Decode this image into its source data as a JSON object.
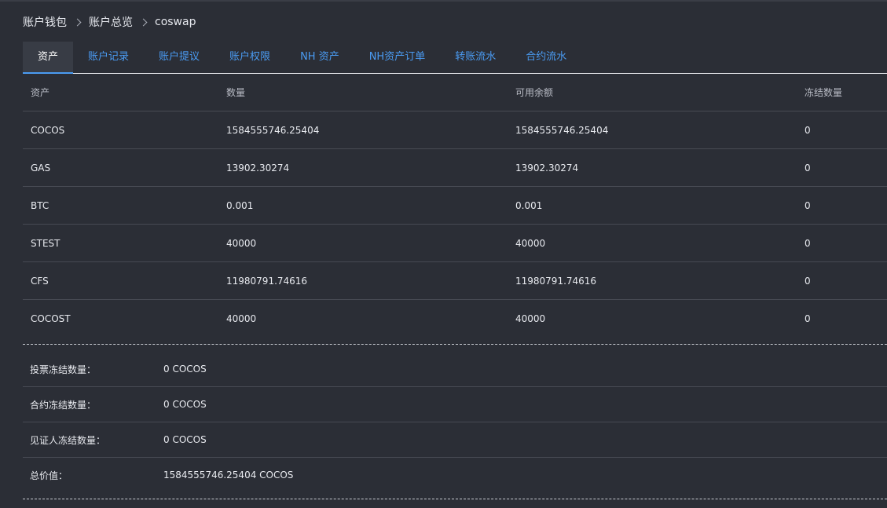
{
  "breadcrumb": [
    "账户钱包",
    "账户总览",
    "coswap"
  ],
  "tabs": [
    {
      "label": "资产",
      "active": true
    },
    {
      "label": "账户记录",
      "active": false
    },
    {
      "label": "账户提议",
      "active": false
    },
    {
      "label": "账户权限",
      "active": false
    },
    {
      "label": "NH 资产",
      "active": false
    },
    {
      "label": "NH资产订单",
      "active": false
    },
    {
      "label": "转账流水",
      "active": false
    },
    {
      "label": "合约流水",
      "active": false
    }
  ],
  "table": {
    "headers": [
      "资产",
      "数量",
      "可用余额",
      "冻结数量"
    ],
    "rows": [
      [
        "COCOS",
        "1584555746.25404",
        "1584555746.25404",
        "0"
      ],
      [
        "GAS",
        "13902.30274",
        "13902.30274",
        "0"
      ],
      [
        "BTC",
        "0.001",
        "0.001",
        "0"
      ],
      [
        "STEST",
        "40000",
        "40000",
        "0"
      ],
      [
        "CFS",
        "11980791.74616",
        "11980791.74616",
        "0"
      ],
      [
        "COCOST",
        "40000",
        "40000",
        "0"
      ]
    ]
  },
  "summary": [
    {
      "label": "投票冻结数量：",
      "value": "0 COCOS"
    },
    {
      "label": "合约冻结数量：",
      "value": "0 COCOS"
    },
    {
      "label": "见证人冻结数量：",
      "value": "0 COCOS"
    },
    {
      "label": "总价值：",
      "value": "1584555746.25404 COCOS"
    }
  ],
  "colors": {
    "background": "#2b2e36",
    "accent": "#4a9bf2",
    "text": "#e8eaef"
  }
}
